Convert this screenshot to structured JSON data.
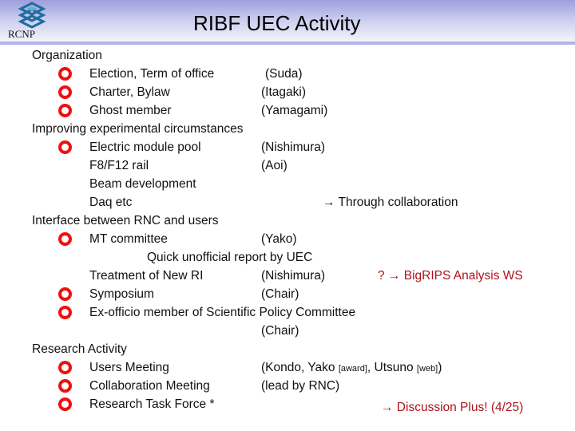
{
  "header": {
    "logo_label": "RCNP",
    "title": "RIBF UEC Activity"
  },
  "colors": {
    "bullet": "#ee1111",
    "accent_text": "#b0121b",
    "header_band": "#9c9fdc",
    "header_rule": "#b3b2ea"
  },
  "sections": {
    "organization": {
      "heading": "Organization",
      "items": [
        {
          "label": "Election, Term of office",
          "owner": "(Suda)"
        },
        {
          "label": "Charter, Bylaw",
          "owner": "(Itagaki)"
        },
        {
          "label": "Ghost member",
          "owner": "(Yamagami)"
        }
      ]
    },
    "improving": {
      "heading": "Improving experimental circumstances",
      "items": [
        {
          "label": "Electric module pool",
          "owner": "(Nishimura)"
        },
        {
          "label": "F8/F12 rail",
          "owner": "(Aoi)"
        },
        {
          "label": "Beam development"
        },
        {
          "label": "Daq etc",
          "note": "→ Through collaboration"
        }
      ]
    },
    "interface": {
      "heading": "Interface between RNC and users",
      "items": [
        {
          "label": "MT committee",
          "owner": "(Yako)"
        },
        {
          "label": "Quick unofficial report by UEC"
        },
        {
          "label": "Treatment of New RI",
          "owner": "(Nishimura)",
          "note": "? → BigRIPS Analysis WS"
        },
        {
          "label": "Symposium",
          "owner": "(Chair)"
        },
        {
          "label": "Ex-officio member of Scientific Policy Committee",
          "owner": "(Chair)"
        }
      ]
    },
    "research": {
      "heading": "Research Activity",
      "items": [
        {
          "label": "Users Meeting",
          "owner_parts": [
            "(Kondo, Yako ",
            "[award]",
            ", Utsuno ",
            "[web]",
            ")"
          ]
        },
        {
          "label": "Collaboration Meeting",
          "owner": "(lead by RNC)"
        },
        {
          "label": "Research Task Force *",
          "note": "→ Discussion Plus! (4/25)"
        }
      ]
    }
  }
}
